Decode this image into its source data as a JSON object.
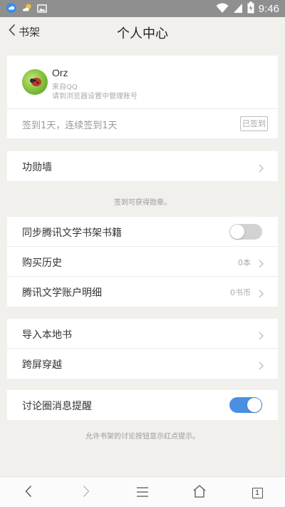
{
  "status_bar": {
    "time": "9:46",
    "icons": [
      "cloud-app-icon",
      "weather-icon",
      "image-icon",
      "wifi-icon",
      "signal-icon",
      "battery-icon"
    ]
  },
  "header": {
    "back_label": "书架",
    "title": "个人中心"
  },
  "profile": {
    "nickname": "Orz",
    "source": "来自QQ",
    "manage_hint": "请到浏览器设置中管理账号",
    "checkin_text": "签到1天，连续签到1天",
    "checked_label": "已签到"
  },
  "medal": {
    "label": "功勋墙",
    "note": "签到可获得勋章。"
  },
  "sync_section": {
    "sync_label": "同步腾讯文学书架书籍",
    "sync_enabled": false,
    "purchase_label": "购买历史",
    "purchase_value": "0本",
    "account_label": "腾讯文学账户明细",
    "account_value": "0书币"
  },
  "tools": {
    "import_label": "导入本地书",
    "cross_label": "跨屏穿越"
  },
  "discussion": {
    "label": "讨论圈消息提醒",
    "enabled": true,
    "note": "允许书架的讨论按钮显示红点提示。"
  },
  "bottom_nav": {
    "tab_count": "1"
  },
  "colors": {
    "accent": "#4a90e2",
    "background": "#f1f0ed",
    "status_bar": "#8f8f8f"
  }
}
